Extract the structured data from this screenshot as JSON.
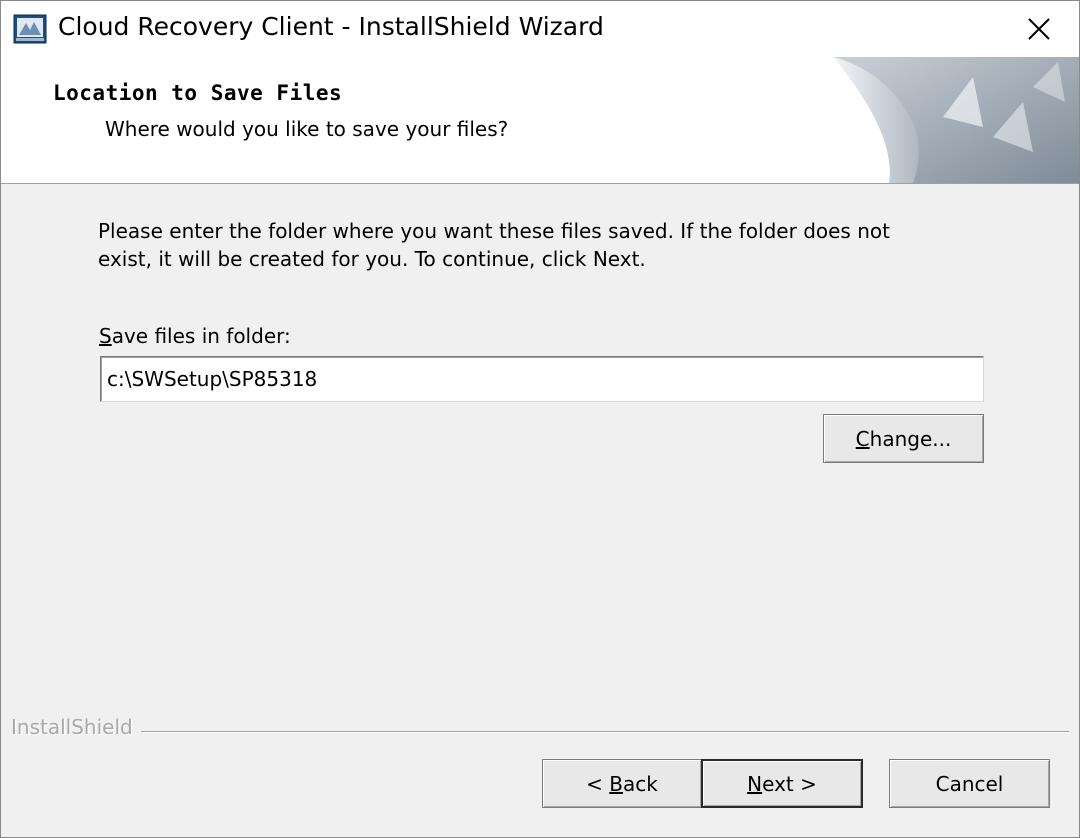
{
  "window": {
    "title": "Cloud Recovery Client - InstallShield Wizard",
    "icon": "installshield-app-icon",
    "close_icon": "close-icon"
  },
  "header": {
    "title": "Location to Save Files",
    "subtitle": "Where would you like to save your files?"
  },
  "body": {
    "instructions_line1": "Please enter the folder where you want these files saved.  If the folder does not",
    "instructions_line2": "exist, it will be created for you.   To continue, click Next.",
    "folder_label_mnemonic": "S",
    "folder_label_rest": "ave files in folder:",
    "folder_value": "c:\\SWSetup\\SP85318",
    "change_button_mnemonic": "C",
    "change_button_rest": "hange..."
  },
  "footer": {
    "brand": "InstallShield",
    "back_button_prefix": "< ",
    "back_button_mnemonic": "B",
    "back_button_rest": "ack",
    "next_button_mnemonic": "N",
    "next_button_rest": "ext >",
    "cancel_button": "Cancel"
  }
}
